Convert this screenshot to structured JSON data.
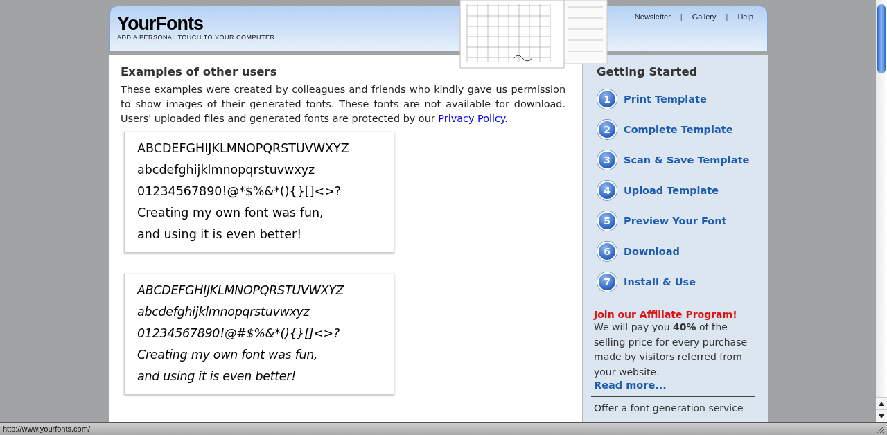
{
  "header": {
    "logo": "YourFonts",
    "tagline": "ADD A PERSONAL TOUCH TO YOUR COMPUTER",
    "nav": [
      {
        "kind": "link",
        "text": "Newsletter"
      },
      {
        "kind": "separator",
        "text": "|"
      },
      {
        "kind": "link",
        "text": "Gallery"
      },
      {
        "kind": "separator",
        "text": "|"
      },
      {
        "kind": "link",
        "text": "Help"
      }
    ]
  },
  "main": {
    "title": "Examples of other users",
    "intro": "These examples were created by colleagues and friends who kindly gave us permission to show images of their generated fonts. These fonts are not available for download. Users' uploaded files and generated fonts are protected by our ",
    "intro_link": "Privacy Policy",
    "intro_end": ".",
    "samples": [
      {
        "kind": "upright",
        "lines": [
          "ABCDEFGHIJKLMNOPQRSTUVWXYZ",
          "abcdefghijklmnopqrstuvwxyz",
          "01234567890!@*$%&*(){}[]<>?",
          "Creating my own font was fun,",
          "and using it is even better!"
        ]
      },
      {
        "kind": "slanted",
        "lines": [
          "ABCDEFGHIJKLMNOPQRSTUVWXYZ",
          "abcdefghijklmnopqrstuvwxyz",
          "01234567890!@#$%&*(){}[]<>?",
          "Creating my own font was  fun,",
          "and using it is even better!"
        ]
      }
    ]
  },
  "sidebar": {
    "title": "Getting Started",
    "steps": [
      {
        "number": "1",
        "label": "Print Template"
      },
      {
        "number": "2",
        "label": "Complete Template"
      },
      {
        "number": "3",
        "label": "Scan & Save Template"
      },
      {
        "number": "4",
        "label": "Upload Template"
      },
      {
        "number": "5",
        "label": "Preview Your Font"
      },
      {
        "number": "6",
        "label": "Download"
      },
      {
        "number": "7",
        "label": "Install & Use"
      }
    ],
    "affiliate": {
      "title": "Join our Affiliate Program!",
      "text": "We will pay you **40%** of the selling price for every purchase made by visitors referred from your website.",
      "link": "Read more..."
    },
    "offer": "Offer a font generation service"
  },
  "status_bar": "http://www.yourfonts.com/"
}
